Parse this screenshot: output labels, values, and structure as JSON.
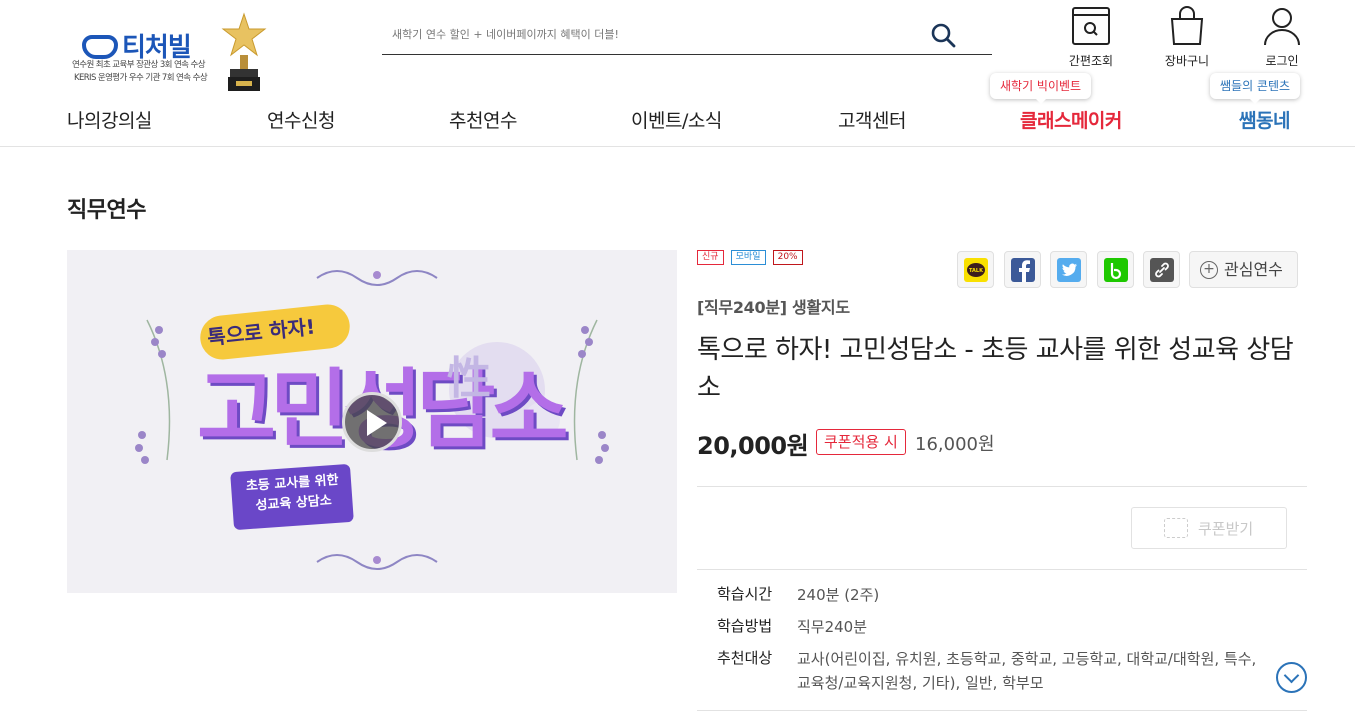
{
  "header": {
    "logo_text": "티처빌",
    "logo_award_line1": "연수원 최초 교육부 장관상 3회 연속 수상",
    "logo_award_line2": "KERIS 운영평가 우수 기관 7회 연속 수상",
    "search_placeholder": "새학기 연수 할인 + 네이버페이까지 혜택이 더블!",
    "utils": [
      {
        "label": "간편조회",
        "icon": "quick-view-icon"
      },
      {
        "label": "장바구니",
        "icon": "cart-icon"
      },
      {
        "label": "로그인",
        "icon": "user-icon"
      }
    ]
  },
  "gnb": {
    "items": [
      "나의강의실",
      "연수신청",
      "추천연수",
      "이벤트/소식",
      "고객센터",
      "클래스메이커",
      "쌤동네"
    ],
    "bubbles": {
      "classmaker": "새학기 빅이벤트",
      "ssem": "쌤들의 콘텐츠"
    },
    "colors": {
      "red": "#e5283b",
      "blue": "#2b73b8"
    }
  },
  "page": {
    "title": "직무연수"
  },
  "thumbnail": {
    "main_text": "고민성담소",
    "banner_top": "톡으로 하자!",
    "banner_sub": "초등 교사를 위한 성교육 상담소",
    "accent_char": "性",
    "play_icon": "play-icon"
  },
  "course": {
    "tags": [
      "신규",
      "모바일",
      "20%"
    ],
    "category": "[직무240분] 생활지도",
    "title": "톡으로 하자! 고민성담소 - 초등 교사를 위한 성교육 상담소",
    "price": "20,000원",
    "coupon_label": "쿠폰적용 시",
    "coupon_price": "16,000원",
    "coupon_button": "쿠폰받기",
    "favorite_button": "관심연수",
    "share_icons": [
      "kakaotalk-icon",
      "facebook-icon",
      "twitter-icon",
      "band-icon",
      "link-icon"
    ],
    "info": [
      {
        "key": "학습시간",
        "value": "240분 (2주)"
      },
      {
        "key": "학습방법",
        "value": "직무240분"
      },
      {
        "key": "추천대상",
        "value": "교사(어린이집, 유치원, 초등학교, 중학교, 고등학교, 대학교/대학원, 특수, 교육청/교육지원청, 기타), 일반, 학부모"
      }
    ]
  }
}
